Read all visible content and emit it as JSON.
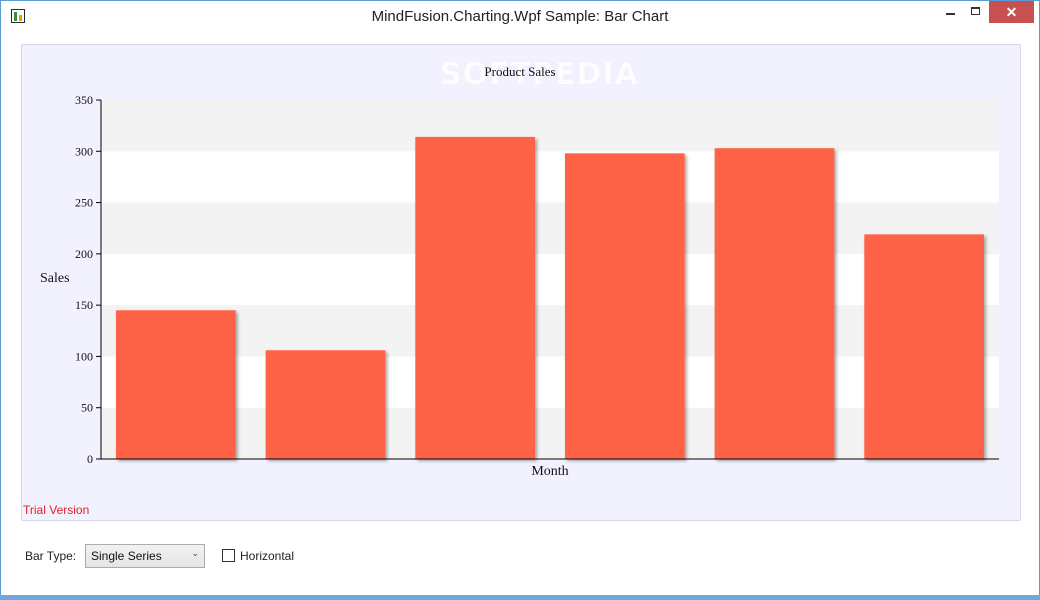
{
  "window": {
    "title": "MindFusion.Charting.Wpf Sample: Bar Chart"
  },
  "watermark": "SOFTPEDIA",
  "chart_data": {
    "type": "bar",
    "title": "Product Sales",
    "xlabel": "Month",
    "ylabel": "Sales",
    "categories": [
      "",
      "",
      "",
      "",
      "",
      ""
    ],
    "values": [
      145,
      106,
      314,
      298,
      303,
      219
    ],
    "ylim": [
      0,
      350
    ],
    "yticks": [
      "0",
      "50",
      "100",
      "150",
      "200",
      "250",
      "300",
      "350"
    ],
    "bar_color": "#ff6347",
    "grid": "alternating horizontal bands",
    "band_colors": [
      "#f3f3f3",
      "#ffffff"
    ],
    "legend": "none"
  },
  "trial_text": "Trial Version",
  "controls": {
    "bar_type_label": "Bar Type:",
    "bar_type_value": "Single Series",
    "horizontal_label": "Horizontal",
    "horizontal_checked": false
  },
  "colors": {
    "panel_bg": "#f2f2ff",
    "trial": "#e0202a",
    "close_button": "#c75050"
  }
}
